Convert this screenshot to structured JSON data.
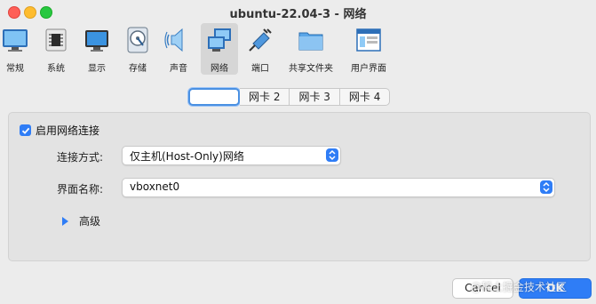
{
  "window": {
    "title": "ubuntu-22.04-3 - 网络"
  },
  "toolbar": {
    "items": [
      {
        "label": "常规",
        "icon": "monitor-icon"
      },
      {
        "label": "系统",
        "icon": "chip-icon"
      },
      {
        "label": "显示",
        "icon": "display-icon"
      },
      {
        "label": "存储",
        "icon": "disk-icon"
      },
      {
        "label": "声音",
        "icon": "speaker-icon"
      },
      {
        "label": "网络",
        "icon": "network-icon",
        "selected": true
      },
      {
        "label": "端口",
        "icon": "port-icon"
      },
      {
        "label": "共享文件夹",
        "icon": "folder-icon"
      },
      {
        "label": "用户界面",
        "icon": "window-icon"
      }
    ]
  },
  "tabs": [
    {
      "label": "",
      "active": true
    },
    {
      "label": "网卡 2"
    },
    {
      "label": "网卡 3"
    },
    {
      "label": "网卡 4"
    }
  ],
  "form": {
    "enable_label": "启用网络连接",
    "enable_checked": true,
    "attach_label": "连接方式:",
    "attach_value": "仅主机(Host-Only)网络",
    "name_label": "界面名称:",
    "name_value": "vboxnet0",
    "advanced_label": "高级"
  },
  "buttons": {
    "cancel": "Cancel",
    "ok": "OK"
  },
  "watermark": "@稀土掘金技术社区",
  "colors": {
    "accent": "#2f7df6",
    "close": "#fe5f57",
    "minimize": "#febc2e",
    "maximize": "#28c840"
  }
}
